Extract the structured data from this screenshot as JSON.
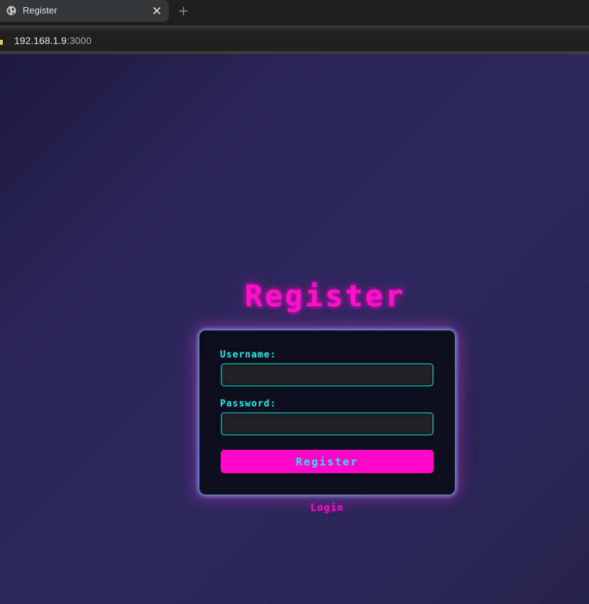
{
  "browser": {
    "tab": {
      "title": "Register",
      "favicon": "globe-icon"
    },
    "new_tab_icon": "plus-icon",
    "address": {
      "host": "192.168.1.9",
      "port": ":3000"
    }
  },
  "page": {
    "title": "Register",
    "form": {
      "username_label": "Username:",
      "username_value": "",
      "password_label": "Password:",
      "password_value": "",
      "submit_label": "Register"
    },
    "login_link": "Login"
  },
  "colors": {
    "accent_pink": "#ff12c8",
    "accent_cyan": "#18f2ef",
    "card_bg": "#0e0d1d",
    "page_bg": "#2c2558"
  }
}
